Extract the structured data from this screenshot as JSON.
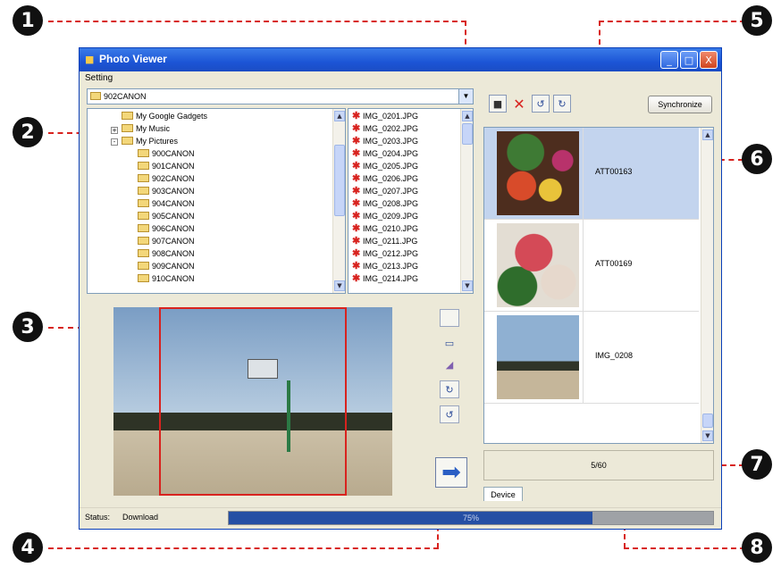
{
  "window": {
    "title": "Photo Viewer",
    "menu": "Setting",
    "buttons": {
      "minimize": "_",
      "maximize": "□",
      "close": "X"
    }
  },
  "folder_combo": {
    "value": "902CANON"
  },
  "tree": {
    "items": [
      {
        "label": "My Google Gadgets",
        "expander": ""
      },
      {
        "label": "My Music",
        "expander": "+"
      },
      {
        "label": "My Pictures",
        "expander": "-"
      },
      {
        "label": "900CANON",
        "expander": ""
      },
      {
        "label": "901CANON",
        "expander": ""
      },
      {
        "label": "902CANON",
        "expander": ""
      },
      {
        "label": "903CANON",
        "expander": ""
      },
      {
        "label": "904CANON",
        "expander": ""
      },
      {
        "label": "905CANON",
        "expander": ""
      },
      {
        "label": "906CANON",
        "expander": ""
      },
      {
        "label": "907CANON",
        "expander": ""
      },
      {
        "label": "908CANON",
        "expander": ""
      },
      {
        "label": "909CANON",
        "expander": ""
      },
      {
        "label": "910CANON",
        "expander": ""
      }
    ]
  },
  "files": {
    "items": [
      "IMG_0201.JPG",
      "IMG_0202.JPG",
      "IMG_0203.JPG",
      "IMG_0204.JPG",
      "IMG_0205.JPG",
      "IMG_0206.JPG",
      "IMG_0207.JPG",
      "IMG_0208.JPG",
      "IMG_0209.JPG",
      "IMG_0210.JPG",
      "IMG_0211.JPG",
      "IMG_0212.JPG",
      "IMG_0213.JPG",
      "IMG_0214.JPG"
    ]
  },
  "right_toolbar": {
    "sync_label": "Synchronize"
  },
  "thumbnails": [
    {
      "name": "ATT00163",
      "selected": true
    },
    {
      "name": "ATT00169",
      "selected": false
    },
    {
      "name": "IMG_0208",
      "selected": false
    }
  ],
  "counter": "5/60",
  "tab": "Device",
  "status": {
    "label": "Status:",
    "value": "Download",
    "progress_text": "75%",
    "progress": 0.75
  },
  "callouts": [
    "1",
    "2",
    "3",
    "4",
    "5",
    "6",
    "7",
    "8"
  ],
  "colors": {
    "accent": "#254fa4",
    "selection": "#c3d4ee",
    "callout_line": "#d8231f"
  }
}
